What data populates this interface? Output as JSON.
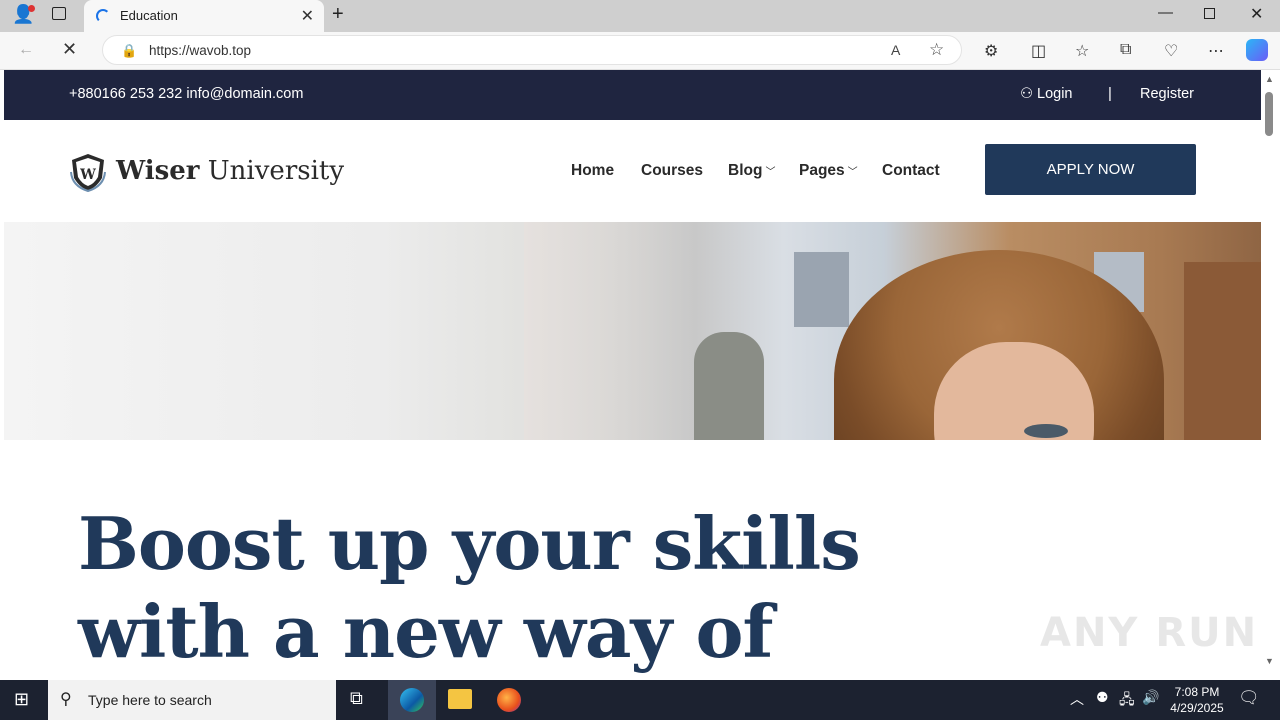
{
  "browser": {
    "tab_title": "Education",
    "url": "https://wavob.top"
  },
  "site": {
    "topbar": {
      "contact": "+880166 253 232 info@domain.com",
      "login": "Login",
      "separator": "|",
      "register": "Register"
    },
    "logo": {
      "bold": "Wiser",
      "rest": " University"
    },
    "nav": {
      "home": "Home",
      "courses": "Courses",
      "blog": "Blog",
      "pages": "Pages",
      "contact": "Contact"
    },
    "apply_button": "APPLY NOW",
    "headline_line1": "Boost up your skills",
    "headline_line2": "with a new way of",
    "colors": {
      "topbar": "#1f2540",
      "brand": "#20395a"
    }
  },
  "watermark": "ANY RUN",
  "taskbar": {
    "search_placeholder": "Type here to search",
    "time": "7:08 PM",
    "date": "4/29/2025"
  }
}
